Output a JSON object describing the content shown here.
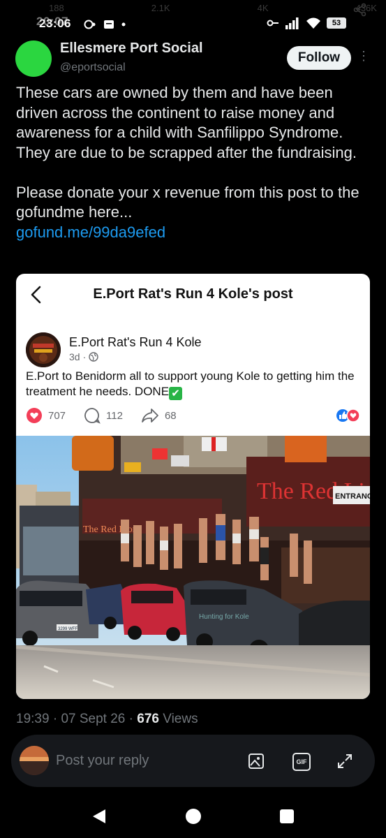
{
  "status_bar": {
    "time": "23:06",
    "time_ghost": "20:07",
    "battery": "53",
    "ghost_stats": [
      "188",
      "2.1K",
      "4K",
      "436K"
    ]
  },
  "post": {
    "display_name": "Ellesmere Port Social",
    "handle": "@eportsocial",
    "follow_label": "Follow",
    "more_label": "⋮",
    "paragraph1": "These cars are owned by them and have been driven across the continent to raise money and awareness for a child with Sanfilippo Syndrome. They are due to be scrapped after the fundraising.",
    "paragraph2": "Please donate your x revenue from this post to the gofundme here...",
    "link": "gofund.me/99da9efed"
  },
  "embed": {
    "title": "E.Port Rat's Run 4 Kole's post",
    "page_name": "E.Port Rat's Run 4 Kole",
    "age": "3d",
    "text": "E.Port to Benidorm all to support young Kole to getting him the treatment he needs. DONE",
    "check_emoji": "✔",
    "likes": "707",
    "comments": "112",
    "shares": "68",
    "photo_sign_left": "The Red Lion",
    "photo_sign_right": "The Red Lio",
    "photo_entrance": "ENTRANC",
    "photo_plate": "3299 WFF",
    "photo_graffiti": "Hunting for Kole"
  },
  "meta": {
    "time": "19:39",
    "date": "07 Sept 26",
    "views_count": "676",
    "views_label": "Views"
  },
  "reply": {
    "placeholder": "Post your reply",
    "gif_label": "GIF"
  },
  "colors": {
    "background": "#000000",
    "text": "#e7e9ea",
    "muted": "#71767b",
    "link": "#1d9bf0",
    "avatar": "#2bd640"
  }
}
